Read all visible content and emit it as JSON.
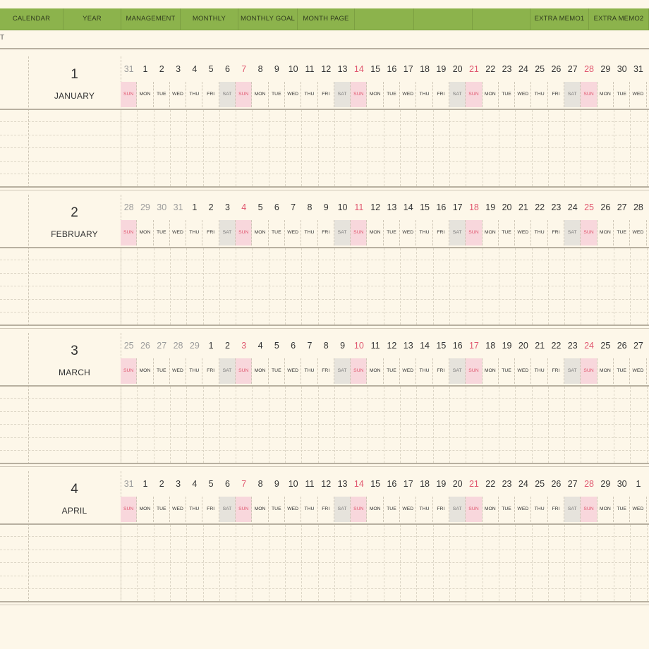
{
  "nav": {
    "tabs": [
      {
        "label": "CALENDAR"
      },
      {
        "label": "YEAR"
      },
      {
        "label": "MANAGEMENT"
      },
      {
        "label": "MONTHLY"
      },
      {
        "label": "MONTHLY GOAL"
      },
      {
        "label": "MONTH PAGE"
      },
      {
        "label": ""
      },
      {
        "label": ""
      },
      {
        "label": ""
      },
      {
        "label": "EXTRA MEMO1"
      },
      {
        "label": "EXTRA MEMO2"
      }
    ]
  },
  "subline": {
    "text": "T"
  },
  "months": [
    {
      "number": "1",
      "name": "JANUARY",
      "dates": [
        "31",
        "1",
        "2",
        "3",
        "4",
        "5",
        "6",
        "7",
        "8",
        "9",
        "10",
        "11",
        "12",
        "13",
        "14",
        "15",
        "16",
        "17",
        "18",
        "19",
        "20",
        "21",
        "22",
        "23",
        "24",
        "25",
        "26",
        "27",
        "28",
        "29",
        "30",
        "31"
      ],
      "first_dim_count": 1
    },
    {
      "number": "2",
      "name": "FEBRUARY",
      "dates": [
        "28",
        "29",
        "30",
        "31",
        "1",
        "2",
        "3",
        "4",
        "5",
        "6",
        "7",
        "8",
        "9",
        "10",
        "11",
        "12",
        "13",
        "14",
        "15",
        "16",
        "17",
        "18",
        "19",
        "20",
        "21",
        "22",
        "23",
        "24",
        "25",
        "26",
        "27",
        "28"
      ],
      "first_dim_count": 4
    },
    {
      "number": "3",
      "name": "MARCH",
      "dates": [
        "25",
        "26",
        "27",
        "28",
        "29",
        "1",
        "2",
        "3",
        "4",
        "5",
        "6",
        "7",
        "8",
        "9",
        "10",
        "11",
        "12",
        "13",
        "14",
        "15",
        "16",
        "17",
        "18",
        "19",
        "20",
        "21",
        "22",
        "23",
        "24",
        "25",
        "26",
        "27"
      ],
      "first_dim_count": 5
    },
    {
      "number": "4",
      "name": "APRIL",
      "dates": [
        "31",
        "1",
        "2",
        "3",
        "4",
        "5",
        "6",
        "7",
        "8",
        "9",
        "10",
        "11",
        "12",
        "13",
        "14",
        "15",
        "16",
        "17",
        "18",
        "19",
        "20",
        "21",
        "22",
        "23",
        "24",
        "25",
        "26",
        "27",
        "28",
        "29",
        "30",
        "1"
      ],
      "first_dim_count": 1
    }
  ],
  "weekdays": [
    "SUN",
    "MON",
    "TUE",
    "WED",
    "THU",
    "FRI",
    "SAT"
  ],
  "colors": {
    "nav_green": "#8cb34c",
    "sunday_red": "#e0576f",
    "sunday_fill": "#f8d7dc",
    "saturday_fill": "#e6e3dc",
    "paper": "#fdf7e9"
  }
}
